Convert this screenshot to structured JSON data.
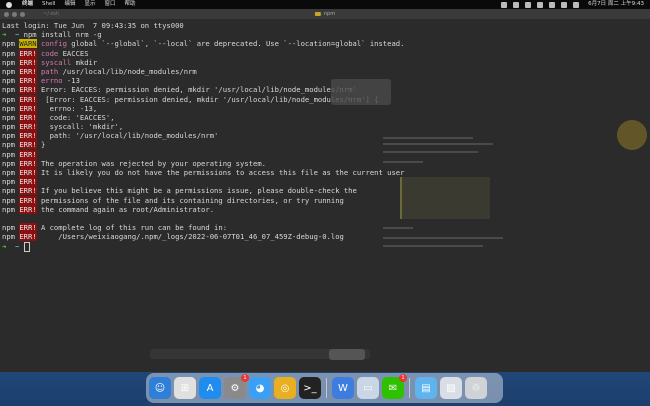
{
  "menubar": {
    "app_name": "终端",
    "items": [
      "Shell",
      "编辑",
      "显示",
      "窗口",
      "帮助"
    ],
    "clock": "6月7日 周二 上午9:43"
  },
  "window": {
    "size_label": "~/-zsh",
    "title": "npm"
  },
  "terminal": {
    "lines": [
      [
        {
          "t": "Last login: Tue Jun  7 09:43:35 on ttys000",
          "c": ""
        }
      ],
      [
        {
          "t": "➜  ",
          "c": "green"
        },
        {
          "t": "~ ",
          "c": "cyan"
        },
        {
          "t": "npm install nrm -g",
          "c": ""
        }
      ],
      [
        {
          "t": "npm ",
          "c": ""
        },
        {
          "t": "WARN",
          "c": "warnbadge"
        },
        {
          "t": " ",
          "c": ""
        },
        {
          "t": "config",
          "c": "pink"
        },
        {
          "t": " global `--global`, `--local` are deprecated. Use `--location=global` instead.",
          "c": ""
        }
      ],
      [
        {
          "t": "npm ",
          "c": ""
        },
        {
          "t": "ERR!",
          "c": "errbadge"
        },
        {
          "t": " ",
          "c": ""
        },
        {
          "t": "code",
          "c": "pink"
        },
        {
          "t": " EACCES",
          "c": ""
        }
      ],
      [
        {
          "t": "npm ",
          "c": ""
        },
        {
          "t": "ERR!",
          "c": "errbadge"
        },
        {
          "t": " ",
          "c": ""
        },
        {
          "t": "syscall",
          "c": "pink"
        },
        {
          "t": " mkdir",
          "c": ""
        }
      ],
      [
        {
          "t": "npm ",
          "c": ""
        },
        {
          "t": "ERR!",
          "c": "errbadge"
        },
        {
          "t": " ",
          "c": ""
        },
        {
          "t": "path",
          "c": "pink"
        },
        {
          "t": " /usr/local/lib/node_modules/nrm",
          "c": ""
        }
      ],
      [
        {
          "t": "npm ",
          "c": ""
        },
        {
          "t": "ERR!",
          "c": "errbadge"
        },
        {
          "t": " ",
          "c": ""
        },
        {
          "t": "errno",
          "c": "pink"
        },
        {
          "t": " -13",
          "c": ""
        }
      ],
      [
        {
          "t": "npm ",
          "c": ""
        },
        {
          "t": "ERR!",
          "c": "errbadge"
        },
        {
          "t": " Error: EACCES: permission denied, mkdir '/usr/local/lib/node_modules/nrm'",
          "c": ""
        }
      ],
      [
        {
          "t": "npm ",
          "c": ""
        },
        {
          "t": "ERR!",
          "c": "errbadge"
        },
        {
          "t": "  [Error: EACCES: permission denied, mkdir '/usr/local/lib/node_modules/nrm'] {",
          "c": ""
        }
      ],
      [
        {
          "t": "npm ",
          "c": ""
        },
        {
          "t": "ERR!",
          "c": "errbadge"
        },
        {
          "t": "   errno: -13,",
          "c": ""
        }
      ],
      [
        {
          "t": "npm ",
          "c": ""
        },
        {
          "t": "ERR!",
          "c": "errbadge"
        },
        {
          "t": "   code: 'EACCES',",
          "c": ""
        }
      ],
      [
        {
          "t": "npm ",
          "c": ""
        },
        {
          "t": "ERR!",
          "c": "errbadge"
        },
        {
          "t": "   syscall: 'mkdir',",
          "c": ""
        }
      ],
      [
        {
          "t": "npm ",
          "c": ""
        },
        {
          "t": "ERR!",
          "c": "errbadge"
        },
        {
          "t": "   path: '/usr/local/lib/node_modules/nrm'",
          "c": ""
        }
      ],
      [
        {
          "t": "npm ",
          "c": ""
        },
        {
          "t": "ERR!",
          "c": "errbadge"
        },
        {
          "t": " }",
          "c": ""
        }
      ],
      [
        {
          "t": "npm ",
          "c": ""
        },
        {
          "t": "ERR!",
          "c": "errbadge"
        }
      ],
      [
        {
          "t": "npm ",
          "c": ""
        },
        {
          "t": "ERR!",
          "c": "errbadge"
        },
        {
          "t": " The operation was rejected by your operating system.",
          "c": ""
        }
      ],
      [
        {
          "t": "npm ",
          "c": ""
        },
        {
          "t": "ERR!",
          "c": "errbadge"
        },
        {
          "t": " It is likely you do not have the permissions to access this file as the current user",
          "c": ""
        }
      ],
      [
        {
          "t": "npm ",
          "c": ""
        },
        {
          "t": "ERR!",
          "c": "errbadge"
        }
      ],
      [
        {
          "t": "npm ",
          "c": ""
        },
        {
          "t": "ERR!",
          "c": "errbadge"
        },
        {
          "t": " If you believe this might be a permissions issue, please double-check the",
          "c": ""
        }
      ],
      [
        {
          "t": "npm ",
          "c": ""
        },
        {
          "t": "ERR!",
          "c": "errbadge"
        },
        {
          "t": " permissions of the file and its containing directories, or try running",
          "c": ""
        }
      ],
      [
        {
          "t": "npm ",
          "c": ""
        },
        {
          "t": "ERR!",
          "c": "errbadge"
        },
        {
          "t": " the command again as root/Administrator.",
          "c": ""
        }
      ],
      [
        {
          "t": "",
          "c": ""
        }
      ],
      [
        {
          "t": "npm ",
          "c": ""
        },
        {
          "t": "ERR!",
          "c": "errbadge"
        },
        {
          "t": " A complete log of this run can be found in:",
          "c": ""
        }
      ],
      [
        {
          "t": "npm ",
          "c": ""
        },
        {
          "t": "ERR!",
          "c": "errbadge"
        },
        {
          "t": "     /Users/weixiaogang/.npm/_logs/2022-06-07T01_46_07_459Z-debug-0.log",
          "c": ""
        }
      ],
      [
        {
          "t": "➜  ",
          "c": "green"
        },
        {
          "t": "~ ",
          "c": "cyan"
        }
      ]
    ]
  },
  "dock": {
    "apps": [
      {
        "name": "finder-icon",
        "glyph": "☺",
        "color": "#2f7fd8"
      },
      {
        "name": "launchpad-icon",
        "glyph": "⊞",
        "color": "#e0e0e0"
      },
      {
        "name": "app-store-icon",
        "glyph": "A",
        "color": "#1f8cf0"
      },
      {
        "name": "system-preferences-icon",
        "glyph": "⚙",
        "color": "#8a8a8a",
        "badge": "1"
      },
      {
        "name": "qq-icon",
        "glyph": "◕",
        "color": "#3aa0f5"
      },
      {
        "name": "chrome-icon",
        "glyph": "◎",
        "color": "#e8b020"
      },
      {
        "name": "terminal-icon",
        "glyph": ">_",
        "color": "#222"
      },
      {
        "name": "wps-icon",
        "glyph": "W",
        "color": "#3d7de0"
      },
      {
        "name": "preview-icon",
        "glyph": "▭",
        "color": "#c9d6e6"
      },
      {
        "name": "wechat-icon",
        "glyph": "✉",
        "color": "#2dc100",
        "badge": "1"
      },
      {
        "name": "folder-icon",
        "glyph": "▤",
        "color": "#5fb4f0"
      },
      {
        "name": "image-icon",
        "glyph": "▨",
        "color": "#d8dde6"
      },
      {
        "name": "trash-icon",
        "glyph": "♲",
        "color": "#cfd3d8"
      }
    ]
  }
}
